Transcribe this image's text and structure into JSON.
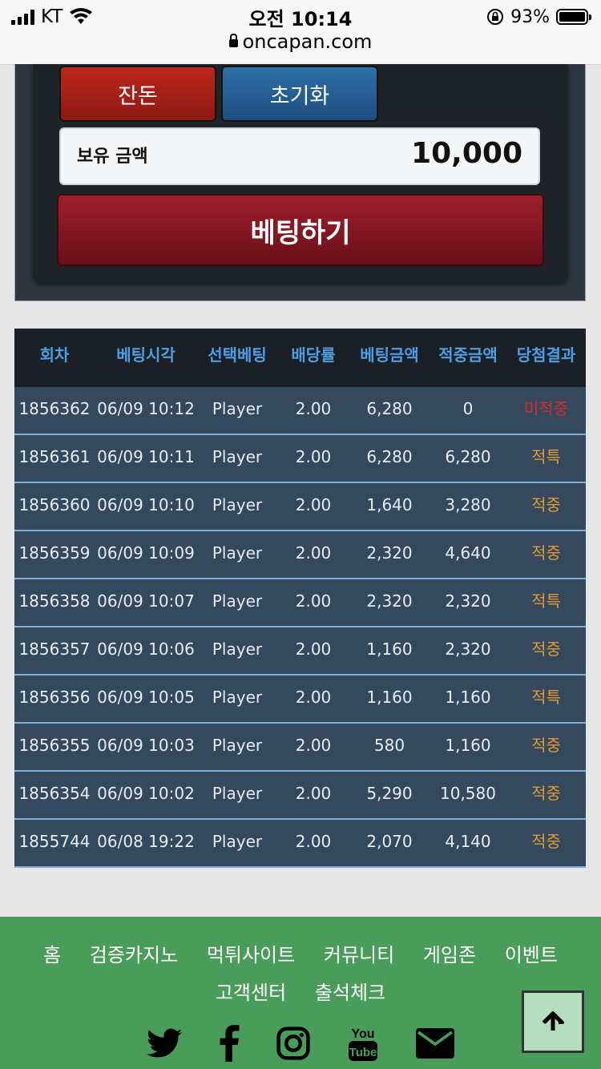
{
  "status": {
    "carrier": "KT",
    "time": "오전 10:14",
    "battery": "93%",
    "url": "oncapan.com"
  },
  "controls": {
    "balance_button": "잔돈",
    "reset_button": "초기화",
    "balance_label": "보유 금액",
    "balance_value": "10,000",
    "bet_button": "베팅하기"
  },
  "table": {
    "headers": [
      "회차",
      "베팅시각",
      "선택베팅",
      "배당률",
      "베팅금액",
      "적중금액",
      "당첨결과"
    ],
    "rows": [
      [
        "1856362",
        "06/09 10:12",
        "Player",
        "2.00",
        "6,280",
        "0",
        "미적중"
      ],
      [
        "1856361",
        "06/09 10:11",
        "Player",
        "2.00",
        "6,280",
        "6,280",
        "적특"
      ],
      [
        "1856360",
        "06/09 10:10",
        "Player",
        "2.00",
        "1,640",
        "3,280",
        "적중"
      ],
      [
        "1856359",
        "06/09 10:09",
        "Player",
        "2.00",
        "2,320",
        "4,640",
        "적중"
      ],
      [
        "1856358",
        "06/09 10:07",
        "Player",
        "2.00",
        "2,320",
        "2,320",
        "적특"
      ],
      [
        "1856357",
        "06/09 10:06",
        "Player",
        "2.00",
        "1,160",
        "2,320",
        "적중"
      ],
      [
        "1856356",
        "06/09 10:05",
        "Player",
        "2.00",
        "1,160",
        "1,160",
        "적특"
      ],
      [
        "1856355",
        "06/09 10:03",
        "Player",
        "2.00",
        "580",
        "1,160",
        "적중"
      ],
      [
        "1856354",
        "06/09 10:02",
        "Player",
        "2.00",
        "5,290",
        "10,580",
        "적중"
      ],
      [
        "1855744",
        "06/08 19:22",
        "Player",
        "2.00",
        "2,070",
        "4,140",
        "적중"
      ]
    ]
  },
  "footer": {
    "nav_row1": [
      "홈",
      "검증카지노",
      "먹튀사이트",
      "커뮤니티",
      "게임존",
      "이벤트"
    ],
    "nav_row2": [
      "고객센터",
      "출석체크"
    ],
    "socials": [
      "twitter-icon",
      "facebook-icon",
      "instagram-icon",
      "youtube-icon",
      "mail-icon"
    ]
  },
  "colors": {
    "result_lose": "#d92d2d",
    "result_win": "#e39b2b",
    "header_text": "#4d9ee3",
    "footer_bg": "#4a9c5a"
  }
}
